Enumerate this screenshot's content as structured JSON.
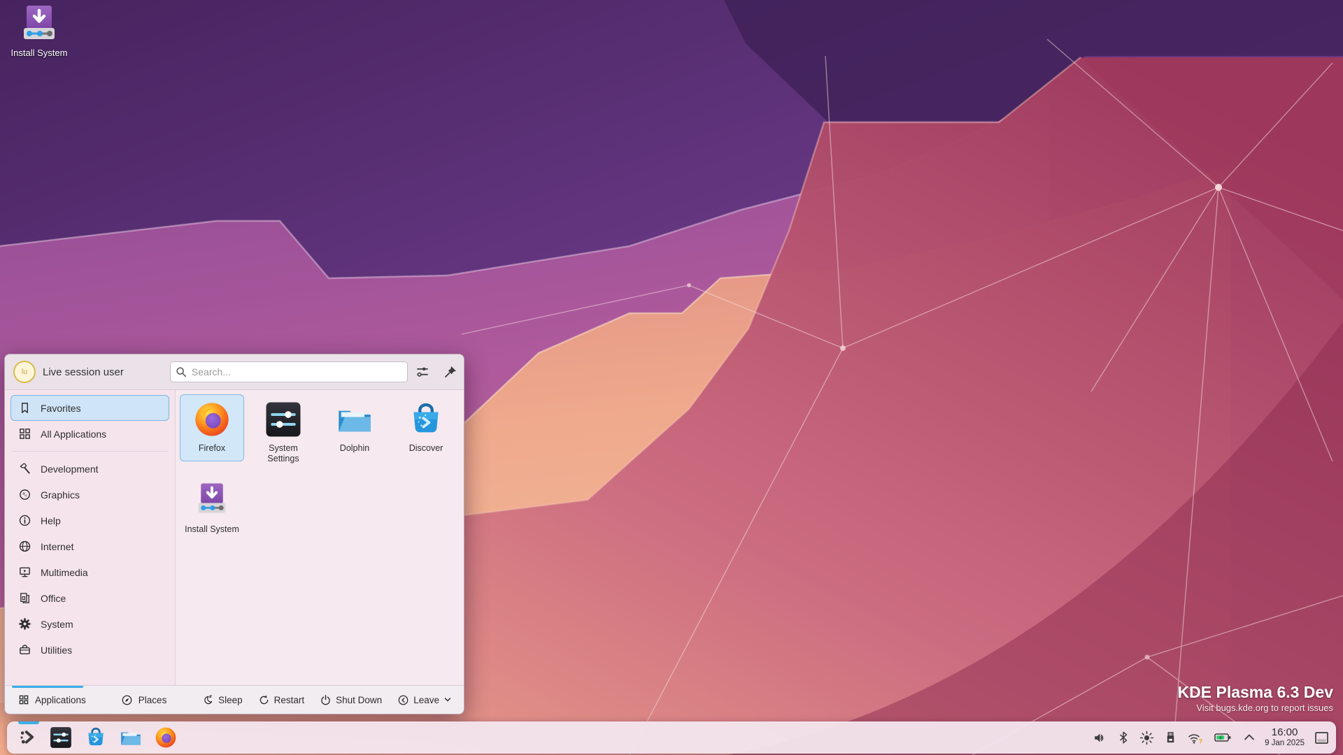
{
  "desktop": {
    "shortcut_label": "Install System",
    "credit": {
      "title": "KDE Plasma 6.3 Dev",
      "subtitle": "Visit bugs.kde.org to report issues"
    }
  },
  "launcher": {
    "user_name": "Live session user",
    "user_initials": "lu",
    "search_placeholder": "Search...",
    "sidebar": {
      "items": [
        {
          "label": "Favorites",
          "icon": "bookmark-icon",
          "selected": true
        },
        {
          "label": "All Applications",
          "icon": "grid-icon",
          "selected": false
        }
      ],
      "categories": [
        {
          "label": "Development",
          "icon": "hammer-icon"
        },
        {
          "label": "Graphics",
          "icon": "image-icon"
        },
        {
          "label": "Help",
          "icon": "info-icon"
        },
        {
          "label": "Internet",
          "icon": "globe-icon"
        },
        {
          "label": "Multimedia",
          "icon": "media-icon"
        },
        {
          "label": "Office",
          "icon": "document-icon"
        },
        {
          "label": "System",
          "icon": "gear-icon"
        },
        {
          "label": "Utilities",
          "icon": "toolbox-icon"
        }
      ]
    },
    "apps": [
      {
        "label": "Firefox",
        "selected": true
      },
      {
        "label": "System Settings",
        "selected": false
      },
      {
        "label": "Dolphin",
        "selected": false
      },
      {
        "label": "Discover",
        "selected": false
      },
      {
        "label": "Install System",
        "selected": false
      }
    ],
    "footer": {
      "tabs": [
        {
          "label": "Applications",
          "icon": "grid-icon",
          "active": true
        },
        {
          "label": "Places",
          "icon": "compass-icon",
          "active": false
        }
      ],
      "actions": [
        {
          "label": "Sleep",
          "icon": "moon-icon"
        },
        {
          "label": "Restart",
          "icon": "restart-icon"
        },
        {
          "label": "Shut Down",
          "icon": "power-icon"
        },
        {
          "label": "Leave",
          "icon": "leave-icon",
          "has_menu": true
        }
      ]
    }
  },
  "panel": {
    "taskbar_items": [
      {
        "name": "application-launcher",
        "active": true
      },
      {
        "name": "system-settings",
        "active": false
      },
      {
        "name": "discover",
        "active": false
      },
      {
        "name": "dolphin",
        "active": false
      },
      {
        "name": "firefox",
        "active": false
      }
    ],
    "tray_icons": [
      "volume",
      "bluetooth",
      "brightness",
      "removable-device",
      "wifi",
      "battery",
      "expand-tray"
    ],
    "clock": {
      "time": "16:00",
      "date": "9 Jan 2025"
    }
  },
  "colors": {
    "accent": "#3daee9",
    "selection_fill": "#cfe4f6",
    "selection_border": "#7db6e5",
    "wifi_warning": "#f0a30a",
    "battery_charge": "#2ecc71",
    "install_icon_purple": "#8a53ae",
    "credit_text": "#ffffff"
  }
}
